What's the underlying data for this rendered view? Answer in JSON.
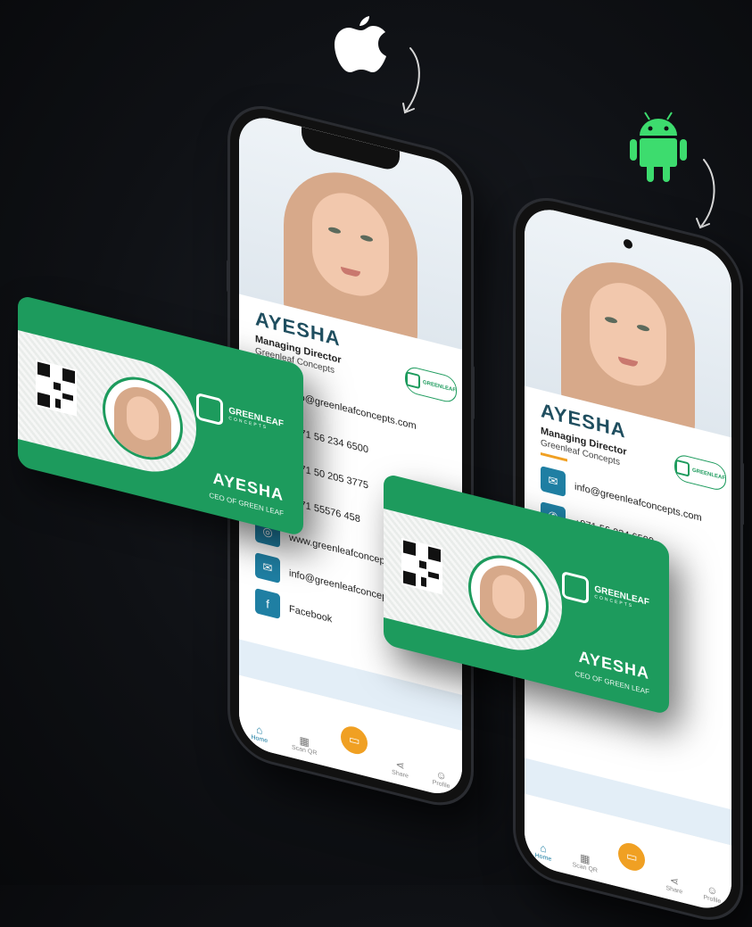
{
  "platforms": {
    "ios": "apple-icon",
    "android": "android-icon"
  },
  "colors": {
    "brand_green": "#1d9b5d",
    "name_blue": "#1f4e5f",
    "icon_blue": "#1f7fa3",
    "accent_orange": "#f0a023"
  },
  "profile": {
    "name": "AYESHA",
    "role": "Managing Director",
    "company": "Greenleaf Concepts",
    "badge": "GREENLEAF"
  },
  "phone1": {
    "contacts": [
      {
        "icon": "mail-icon",
        "text": "info@greenleafconcepts.com"
      },
      {
        "icon": "phone-icon",
        "text": "+971 56 234 6500"
      },
      {
        "icon": "phone-icon",
        "text": "+971 50 205 3775"
      },
      {
        "icon": "phone-icon",
        "text": "+971 55576 458"
      },
      {
        "icon": "globe-icon",
        "text": "www.greenleafconcepts.com"
      },
      {
        "icon": "mail-icon",
        "text": "info@greenleafconcepts.com"
      },
      {
        "icon": "facebook-icon",
        "text": "Facebook"
      }
    ]
  },
  "phone2": {
    "contacts": [
      {
        "icon": "mail-icon",
        "text": "info@greenleafconcepts.com"
      },
      {
        "icon": "phone-icon",
        "text": "+971 56 234 6500"
      }
    ]
  },
  "tabbar": {
    "home": "Home",
    "scan": "Scan QR",
    "share": "Share",
    "profile": "Profile"
  },
  "card": {
    "brand": "GREENLEAF",
    "brand_sub": "CONCEPTS",
    "name": "AYESHA",
    "title": "CEO OF GREEN LEAF"
  }
}
